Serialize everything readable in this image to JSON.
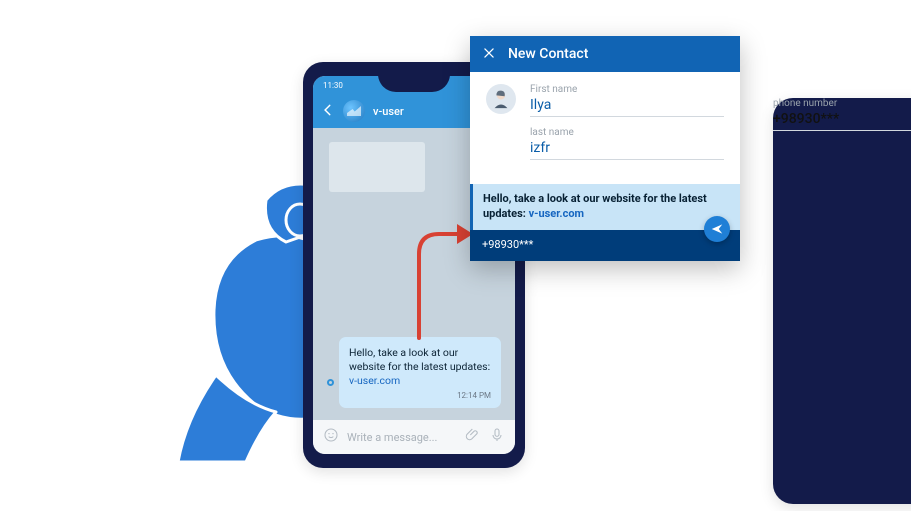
{
  "phone": {
    "status_time": "11:30",
    "chat_name": "v-user",
    "message_text": "Hello, take a look at our website for the latest updates:",
    "message_link": "v-user.com",
    "message_time": "12:14 PM",
    "input_placeholder": "Write a message..."
  },
  "popup": {
    "title": "New Contact",
    "first_name_label": "First name",
    "first_name_value": "Ilya",
    "last_name_label": "last name",
    "last_name_value": "izfr",
    "phone_label": "phone number",
    "phone_value": "+98930***",
    "strip_text": "Hello, take a look at our website for the latest updates:",
    "strip_link": "v-user.com",
    "footer_phone": "+98930***"
  }
}
